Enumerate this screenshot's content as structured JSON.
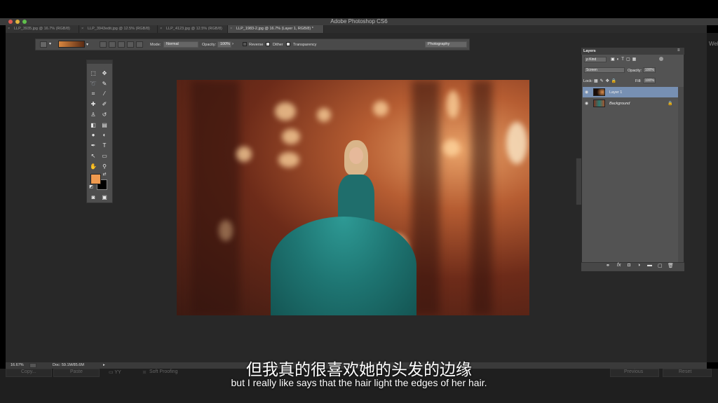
{
  "app_title": "Adobe Photoshop CS6",
  "tabs": [
    {
      "label": "LLP_3935.jpg @ 16.7% (RGB/8)"
    },
    {
      "label": "LLP_3943edit.jpg @ 12.5% (RGB/8)"
    },
    {
      "label": "LLP_4123.jpg @ 12.5% (RGB/8)"
    },
    {
      "label": "LLP_1983-2.jpg @ 16.7% (Layer 1, RGB/8) *"
    }
  ],
  "options_bar": {
    "mode_label": "Mode:",
    "mode_value": "Normal",
    "opacity_label": "Opacity:",
    "opacity_value": "100%",
    "reverse_label": "Reverse",
    "dither_label": "Dither",
    "transparency_label": "Transparency",
    "workspace_value": "Photography"
  },
  "tools": {
    "foreground_color": "#ef9a4f",
    "background_color": "#000000"
  },
  "layers_panel": {
    "title": "Layers",
    "kind_value": "ρ Kind",
    "blend_mode": "Screen",
    "opacity_label": "Opacity:",
    "opacity_value": "100%",
    "lock_label": "Lock:",
    "fill_label": "Fill:",
    "fill_value": "100%",
    "layers": [
      {
        "name": "Layer 1",
        "selected": true
      },
      {
        "name": "Background",
        "selected": false
      }
    ]
  },
  "status_bar": {
    "zoom": "16.67%",
    "doc": "Doc: 59.1M/85.6M"
  },
  "bottom_ui": {
    "copy_label": "Copy...",
    "paste_label": "Paste",
    "soft_proofing_label": "Soft Proofing",
    "previous_label": "Previous",
    "reset_label": "Reset"
  },
  "right_strip_text": "Web",
  "subtitles": {
    "chinese": "但我真的很喜欢她的头发的边缘",
    "english": "but I really like says that the hair light the edges of her hair."
  }
}
